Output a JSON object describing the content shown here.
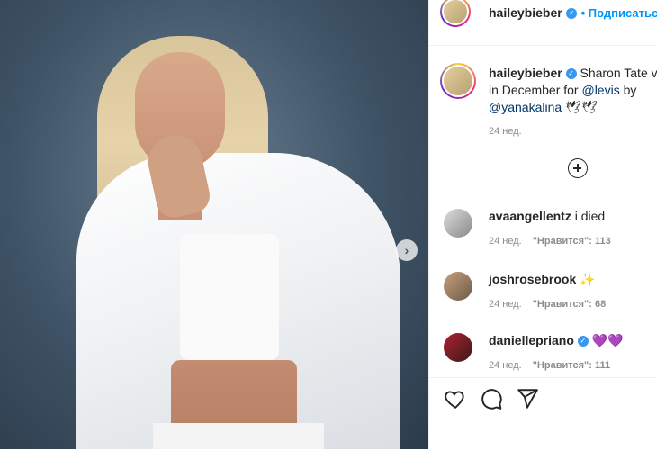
{
  "header": {
    "username": "haileybieber",
    "follow_label": "• Подписаться"
  },
  "caption": {
    "username": "haileybieber",
    "text_part1": "Sharon Tate vib",
    "line2_prefix": "in December for ",
    "mention_levis": "@levis",
    "line2_suffix": " by",
    "mention_yana": "@yanakalina",
    "emoji": "🕊🕊",
    "time": "24 нед."
  },
  "comments": [
    {
      "username": "avaangellentz",
      "text": "i died",
      "time": "24 нед.",
      "likes": "\"Нравится\": 113"
    },
    {
      "username": "joshrosebrook",
      "text": "✨",
      "time": "24 нед.",
      "likes": "\"Нравится\": 68"
    },
    {
      "username": "daniellepriano",
      "text": "💜💜",
      "time": "24 нед.",
      "likes": "\"Нравится\": 111"
    }
  ],
  "icons": [
    "next-arrow-icon",
    "verified-icon",
    "add-comment-icon",
    "heart-icon",
    "comment-icon",
    "share-icon"
  ],
  "colors": {
    "accent": "#0095f6",
    "verified": "#3897f0",
    "meta": "#8e8e8e"
  }
}
